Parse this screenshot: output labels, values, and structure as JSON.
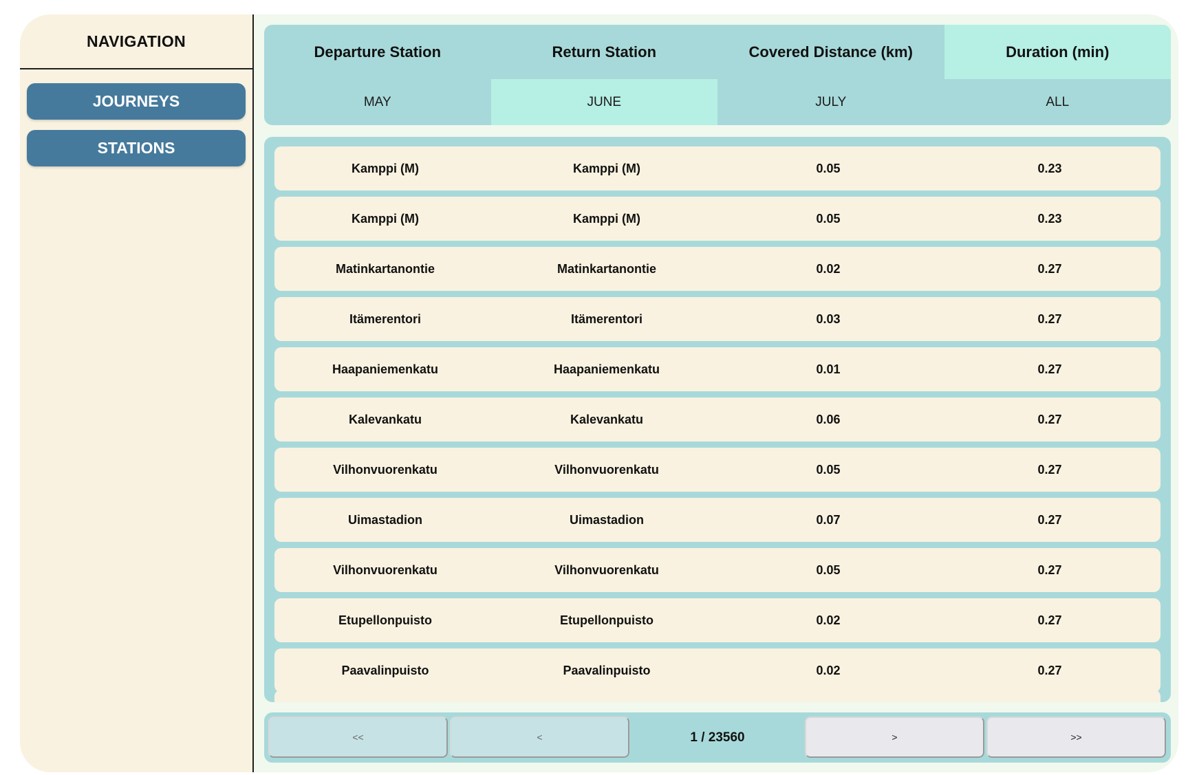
{
  "sidebar": {
    "title": "NAVIGATION",
    "items": [
      {
        "label": "JOURNEYS"
      },
      {
        "label": "STATIONS"
      }
    ]
  },
  "table": {
    "columns": [
      "Departure Station",
      "Return Station",
      "Covered Distance (km)",
      "Duration (min)"
    ],
    "active_sort_column": "Duration (min)",
    "months": [
      "MAY",
      "JUNE",
      "JULY",
      "ALL"
    ],
    "active_month": "JUNE",
    "rows": [
      {
        "departure": "Kamppi (M)",
        "return": "Kamppi (M)",
        "distance": "0.05",
        "duration": "0.23"
      },
      {
        "departure": "Kamppi (M)",
        "return": "Kamppi (M)",
        "distance": "0.05",
        "duration": "0.23"
      },
      {
        "departure": "Matinkartanontie",
        "return": "Matinkartanontie",
        "distance": "0.02",
        "duration": "0.27"
      },
      {
        "departure": "Itämerentori",
        "return": "Itämerentori",
        "distance": "0.03",
        "duration": "0.27"
      },
      {
        "departure": "Haapaniemenkatu",
        "return": "Haapaniemenkatu",
        "distance": "0.01",
        "duration": "0.27"
      },
      {
        "departure": "Kalevankatu",
        "return": "Kalevankatu",
        "distance": "0.06",
        "duration": "0.27"
      },
      {
        "departure": "Vilhonvuorenkatu",
        "return": "Vilhonvuorenkatu",
        "distance": "0.05",
        "duration": "0.27"
      },
      {
        "departure": "Uimastadion",
        "return": "Uimastadion",
        "distance": "0.07",
        "duration": "0.27"
      },
      {
        "departure": "Vilhonvuorenkatu",
        "return": "Vilhonvuorenkatu",
        "distance": "0.05",
        "duration": "0.27"
      },
      {
        "departure": "Etupellonpuisto",
        "return": "Etupellonpuisto",
        "distance": "0.02",
        "duration": "0.27"
      },
      {
        "departure": "Paavalinpuisto",
        "return": "Paavalinpuisto",
        "distance": "0.02",
        "duration": "0.27"
      }
    ]
  },
  "pagination": {
    "first_label": "<<",
    "prev_label": "<",
    "next_label": ">",
    "last_label": ">>",
    "page_indicator": "1 / 23560"
  },
  "colors": {
    "panel_background": "#f9f2e0",
    "table_background": "#a8d9da",
    "active_highlight": "#b6efe4",
    "nav_button": "#457a9c",
    "app_background": "#f1f8ee"
  }
}
